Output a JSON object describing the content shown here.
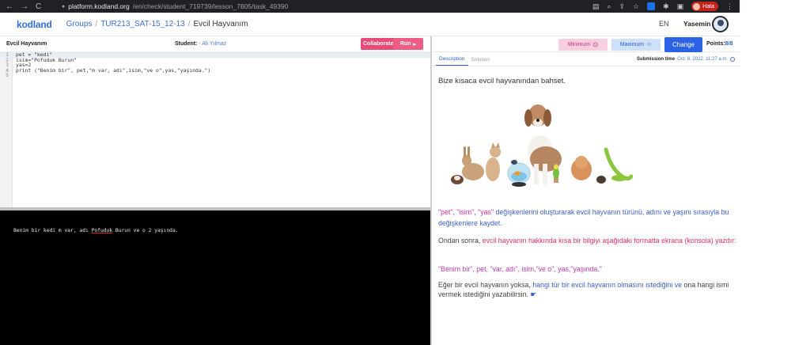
{
  "browser": {
    "nav": {
      "back": "←",
      "forward": "→",
      "reload": "C"
    },
    "url_host": "platform.kodland.org",
    "url_path": "/en/check/student_719739/lesson_7805/task_49390",
    "profile_label": "Hata"
  },
  "header": {
    "logo": "kodland",
    "breadcrumb": {
      "groups": "Groups",
      "sep1": "/",
      "group": "TUR213_SAT-15_12-13",
      "sep2": "/",
      "current": "Evcil Hayvanım"
    },
    "language": "EN",
    "username": "Yasemin"
  },
  "editor": {
    "task_name": "Evcil Hayvanım",
    "student_label": "Student:",
    "student_name": "- Ali Yılmaz",
    "collaborate_label": "Collaborate",
    "run_label": "Run",
    "lines": [
      {
        "n": "1",
        "text": "pet = \"kedi\""
      },
      {
        "n": "2",
        "text": "isim=\"Pofuduk Burun\""
      },
      {
        "n": "3",
        "text": "yas=2"
      },
      {
        "n": "4",
        "text": "print (\"Benim bir\", pet,\"m var, adı\",isim,\"ve o\",yas,\"yaşında.\")"
      },
      {
        "n": "5",
        "text": ""
      }
    ]
  },
  "console": {
    "prefix": "Benim bir kedi m var, adı ",
    "underlined": "Pofuduk",
    "suffix": " Burun ve o 2 yaşında."
  },
  "review": {
    "minimum_label": "Minimum",
    "maximum_label": "Maximum",
    "change_label": "Change",
    "points_label": "Points:",
    "points_value": "8/8",
    "tabs": [
      "Description",
      "Solution"
    ],
    "submission_label": "Submission time",
    "submission_time": "Oct. 8, 2022, 11:27 a.m."
  },
  "description": {
    "intro": "Bize kısaca evcil hayvanından bahset.",
    "p1_vars": "\"pet\", \"isim\", \"yas\"",
    "p1_rest": " değişkenlerini oluşturarak evcil hayvanın türünü, adını ve yaşını sırasıyla bu değişkenlere kaydet.",
    "p2_start": "Ondan sonra, ",
    "p2_red": "evcil hayvanın hakkında kısa bir bilgiyi aşağıdaki formatta ekrana (konsola) yazdır:",
    "p3": "\"Benim bir\", pet, \"var, adı\", isim,\"ve o\", yas,\"yaşında.\"",
    "p4_start": "Eğer bir evcil hayvanın yoksa, ",
    "p4_blue": "hangi tür bir evcil hayvanın olmasını istediğini ve",
    "p4_end": " ona hangi ismi vermek istediğini yazabilirsin."
  },
  "icons": {
    "back": "arrow-left-icon",
    "forward": "arrow-right-icon",
    "reload": "reload-icon",
    "lock": "lock-icon",
    "run": "play-icon",
    "clock": "clock-icon"
  },
  "colors": {
    "accent": "#2c63e6",
    "run": "#ee5d83",
    "collaborate": "#e94a78",
    "console_bg": "#000000"
  }
}
